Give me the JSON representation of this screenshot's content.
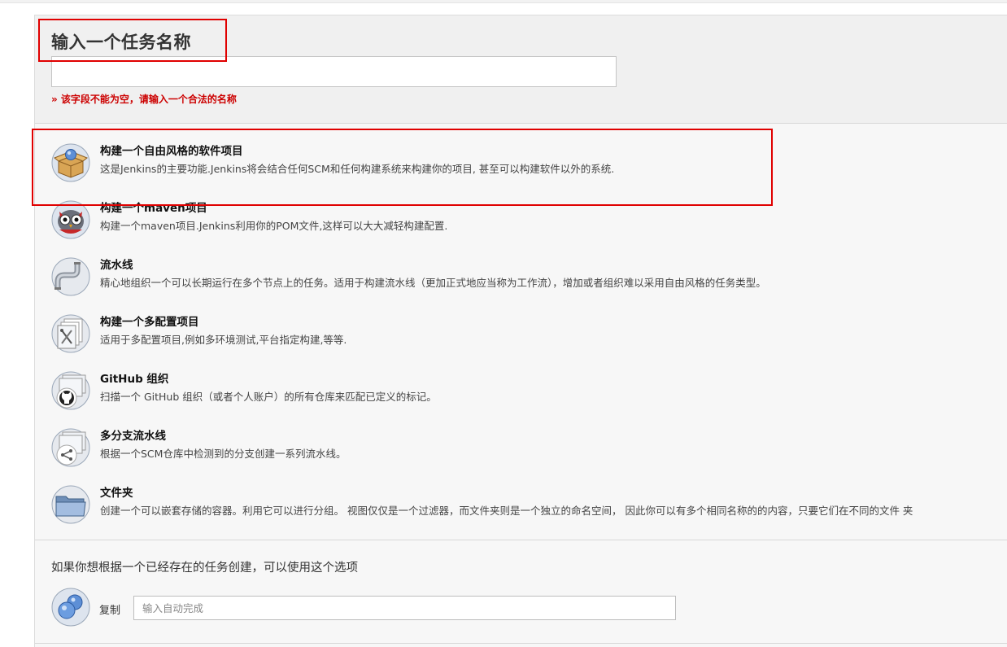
{
  "form": {
    "title": "输入一个任务名称",
    "name_value": "",
    "error": "» 该字段不能为空，请输入一个合法的名称"
  },
  "items": [
    {
      "name": "构建一个自由风格的软件项目",
      "desc": "这是Jenkins的主要功能.Jenkins将会结合任何SCM和任何构建系统来构建你的项目, 甚至可以构建软件以外的系统.",
      "icon": "freestyle-box-icon"
    },
    {
      "name": "构建一个maven项目",
      "desc": "构建一个maven项目.Jenkins利用你的POM文件,这样可以大大减轻构建配置.",
      "icon": "maven-owl-icon"
    },
    {
      "name": "流水线",
      "desc": "精心地组织一个可以长期运行在多个节点上的任务。适用于构建流水线（更加正式地应当称为工作流），增加或者组织难以采用自由风格的任务类型。",
      "icon": "pipeline-icon"
    },
    {
      "name": "构建一个多配置项目",
      "desc": "适用于多配置项目,例如多环境测试,平台指定构建,等等.",
      "icon": "multi-config-icon"
    },
    {
      "name": "GitHub 组织",
      "desc": "扫描一个 GitHub 组织（或者个人账户）的所有仓库来匹配已定义的标记。",
      "icon": "github-org-icon"
    },
    {
      "name": "多分支流水线",
      "desc": "根据一个SCM仓库中检测到的分支创建一系列流水线。",
      "icon": "multibranch-icon"
    },
    {
      "name": "文件夹",
      "desc": "创建一个可以嵌套存储的容器。利用它可以进行分组。 视图仅仅是一个过滤器，而文件夹则是一个独立的命名空间， 因此你可以有多个相同名称的的内容，只要它们在不同的文件 夹",
      "icon": "folder-icon"
    }
  ],
  "copy": {
    "hint": "如果你想根据一个已经存在的任务创建，可以使用这个选项",
    "label": "复制",
    "placeholder": "输入自动完成"
  }
}
